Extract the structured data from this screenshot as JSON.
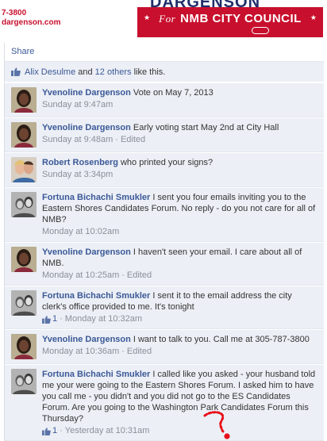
{
  "banner": {
    "phone": "7-3800",
    "site": "dargenson.com",
    "sign_top": "DARGENSON",
    "sign_for": "For",
    "sign_office": "NMB CITY COUNCIL"
  },
  "actions": {
    "share": "Share"
  },
  "likes": {
    "first_name": "Alix Desulme",
    "and": " and ",
    "others": "12 others",
    "suffix": " like this."
  },
  "colors": {
    "link": "#3b5998",
    "sign_red": "#c8102e",
    "meta": "#8a8f99"
  },
  "comments": [
    {
      "author": "Yvenoline Dargenson",
      "text": "Vote on May 7, 2013",
      "time": "Sunday at 9:47am",
      "edited": "",
      "likes": "",
      "avatar": "yvenoline-avatar"
    },
    {
      "author": "Yvenoline Dargenson",
      "text": "Early voting start May 2nd at City Hall",
      "time": "Sunday at 9:48am",
      "edited": "Edited",
      "likes": "",
      "avatar": "yvenoline-avatar"
    },
    {
      "author": "Robert Rosenberg",
      "text": "who printed your signs?",
      "time": "Sunday at 3:34pm",
      "edited": "",
      "likes": "",
      "avatar": "robert-avatar"
    },
    {
      "author": "Fortuna Bichachi Smukler",
      "text": "I sent you four emails inviting you to the Eastern Shores Candidates Forum. No reply - do you not care for all of NMB?",
      "time": "Monday at 10:02am",
      "edited": "",
      "likes": "",
      "avatar": "fortuna-avatar"
    },
    {
      "author": "Yvenoline Dargenson",
      "text": "I haven't seen your email. I care about all of NMB.",
      "time": "Monday at 10:25am",
      "edited": "Edited",
      "likes": "",
      "avatar": "yvenoline-avatar"
    },
    {
      "author": "Fortuna Bichachi Smukler",
      "text": "I sent it to the email address the city clerk's office provided to me. It's tonight",
      "time": "Monday at 10:32am",
      "edited": "",
      "likes": "1",
      "avatar": "fortuna-avatar"
    },
    {
      "author": "Yvenoline Dargenson",
      "text": "I want to talk to you. Call me at 305-787-3800",
      "time": "Monday at 10:36am",
      "edited": "Edited",
      "likes": "",
      "avatar": "yvenoline-avatar"
    },
    {
      "author": "Fortuna Bichachi Smukler",
      "text": "I called like you asked - your husband told me your were going to the Eastern Shores Forum. I asked him to have you call me - you didn't and you did not go to the ES Candidates Forum. Are you going to the Washington Park Candidates Forum this Thursday?",
      "time": "Yesterday at 10:31am",
      "edited": "",
      "likes": "1",
      "avatar": "fortuna-avatar"
    }
  ]
}
